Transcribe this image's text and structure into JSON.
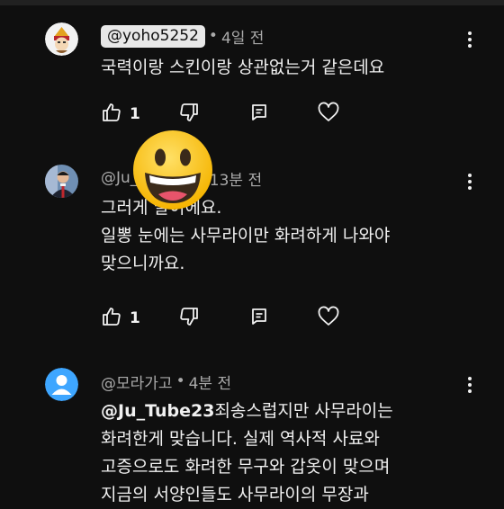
{
  "comments": [
    {
      "handle": "@yoho5252",
      "time": "4일 전",
      "text": "국력이랑 스킨이랑 상관없는거 같은데요",
      "likes": "1",
      "highlighted_handle": true
    },
    {
      "handle": "@Ju_Tube23",
      "time": "13분 전",
      "text": "그러게 말이에요.\n일뽕 눈에는 사무라이만 화려하게 나와야\n맞으니까요.",
      "likes": "1",
      "highlighted_handle": false
    },
    {
      "handle": "@모라가고",
      "time": "4분 전",
      "mention": "@Ju_Tube23",
      "text": "죄송스럽지만 사무라이는\n화려한게 맞습니다. 실제 역사적 사료와\n고증으로도 화려한 무구와 갑옷이 맞으며\n지금의 서양인들도 사무라이의 무장과",
      "highlighted_handle": false
    }
  ],
  "separator": "•",
  "icons": {
    "like": "thumbs-up-icon",
    "dislike": "thumbs-down-icon",
    "reply": "reply-icon",
    "heart": "heart-icon",
    "menu": "more-vert-icon",
    "overlay": "grinning-face-emoji"
  },
  "colors": {
    "background": "#0f0f0f",
    "text": "#f1f1f1",
    "secondary": "#aaaaaa",
    "default_avatar": "#3ea6ff"
  }
}
